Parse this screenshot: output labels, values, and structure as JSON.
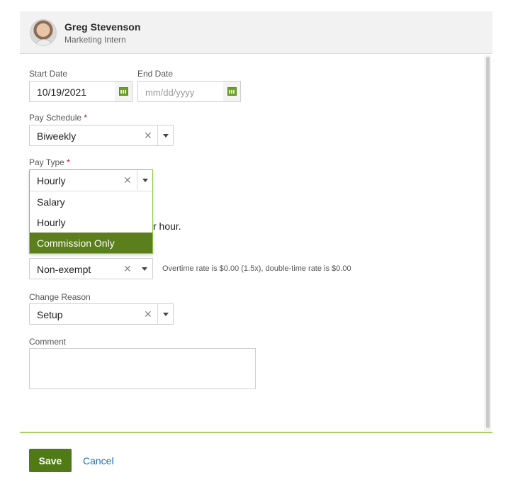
{
  "header": {
    "name": "Greg Stevenson",
    "title": "Marketing Intern"
  },
  "form": {
    "start_date": {
      "label": "Start Date",
      "value": "10/19/2021"
    },
    "end_date": {
      "label": "End Date",
      "placeholder": "mm/dd/yyyy"
    },
    "pay_schedule": {
      "label": "Pay Schedule",
      "required_mark": "*",
      "value": "Biweekly"
    },
    "pay_type": {
      "label": "Pay Type",
      "required_mark": "*",
      "value": "Hourly",
      "options": [
        "Salary",
        "Hourly",
        "Commission Only"
      ],
      "highlighted_option": "Commission Only"
    },
    "partial_text": "r hour.",
    "exemption": {
      "value": "Non-exempt",
      "note": "Overtime rate is $0.00 (1.5x), double-time rate is $0.00"
    },
    "change_reason": {
      "label": "Change Reason",
      "value": "Setup"
    },
    "comment": {
      "label": "Comment",
      "value": ""
    }
  },
  "actions": {
    "save_label": "Save",
    "cancel_label": "Cancel"
  },
  "colors": {
    "accent": "#5b7f1c",
    "save_button": "#4f7a16",
    "link": "#1c6fb8",
    "required": "#d0021b",
    "divider": "#a7cf6a"
  },
  "icons": [
    "calendar-icon",
    "clear-icon",
    "chevron-down-icon",
    "avatar"
  ]
}
